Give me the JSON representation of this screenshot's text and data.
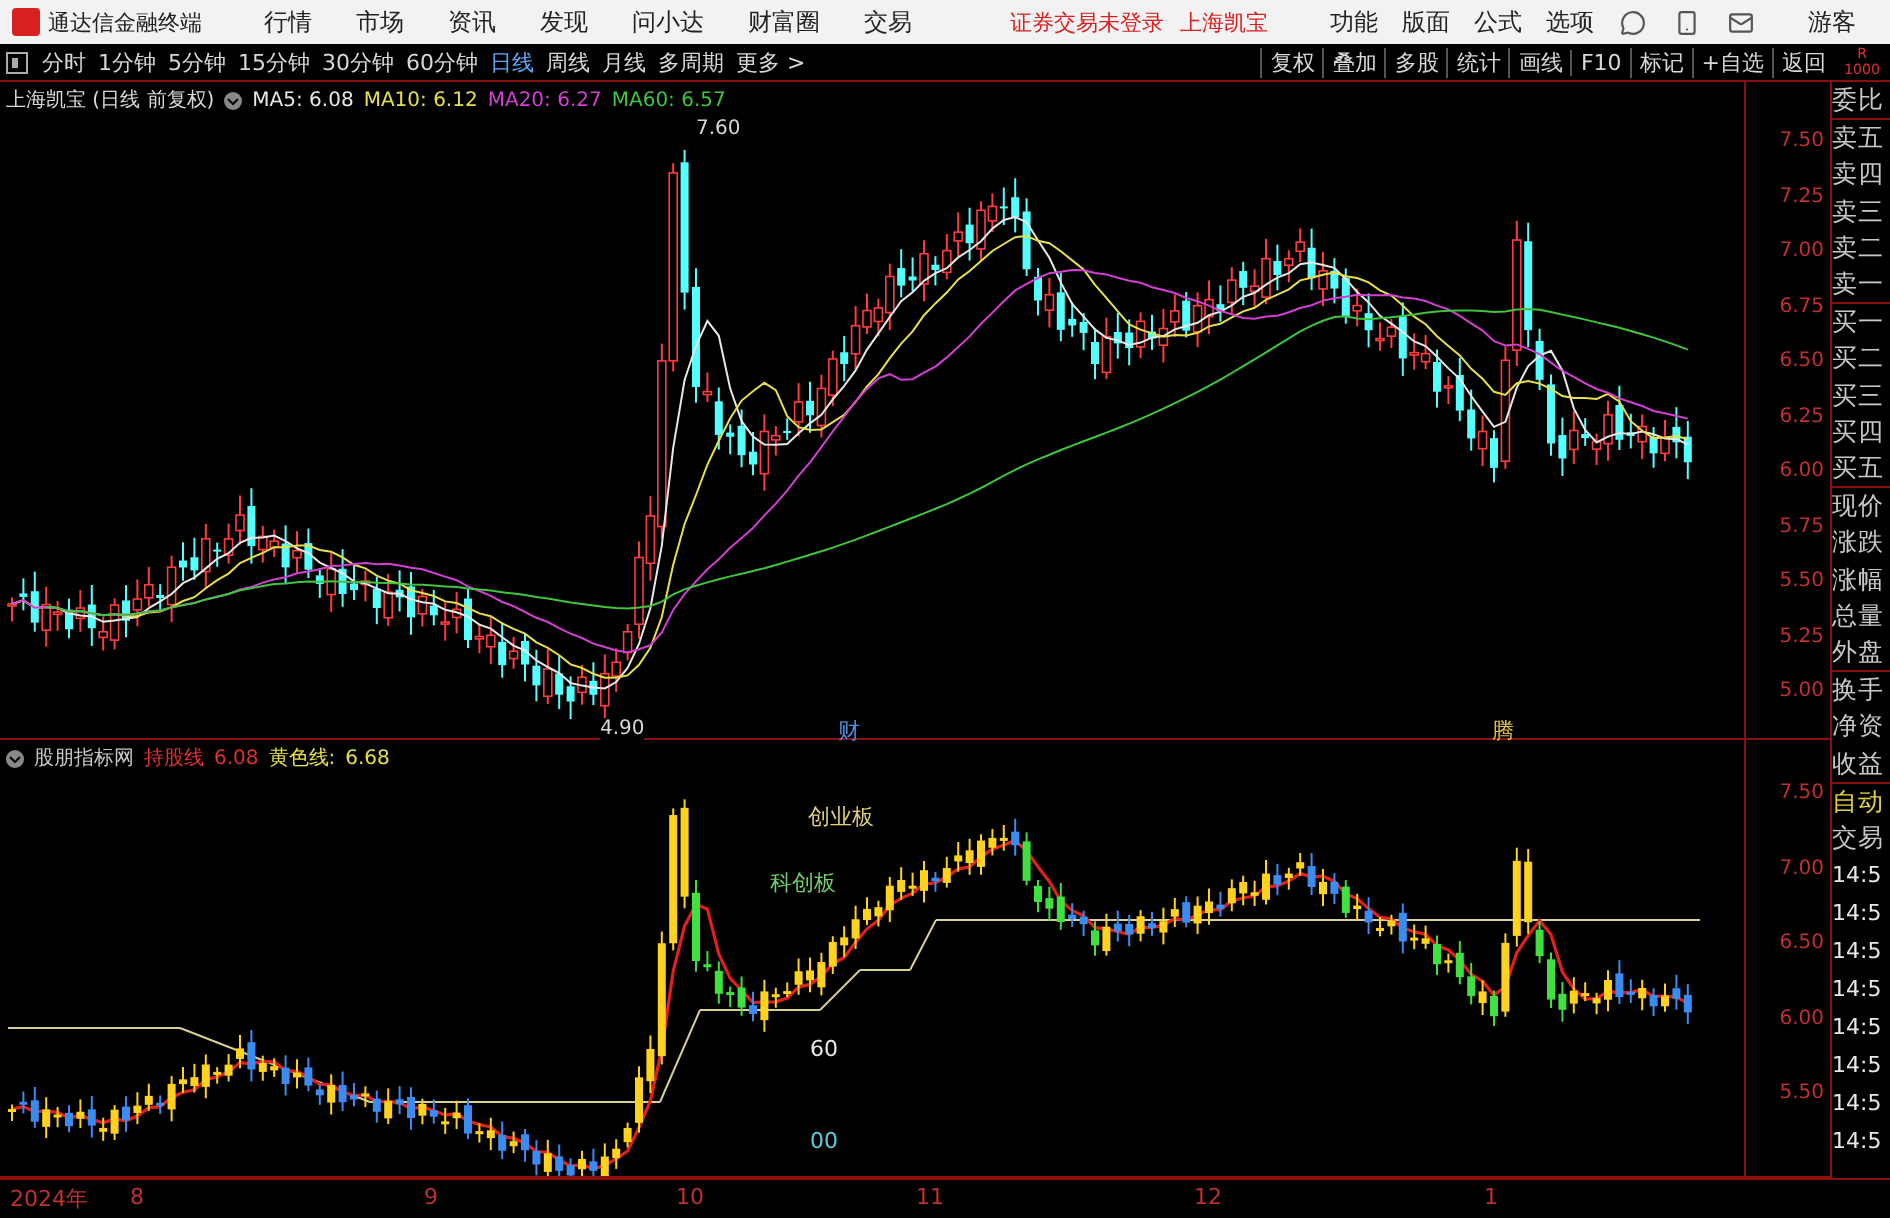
{
  "menu_bar": {
    "app_title": "通达信金融终端",
    "menus": [
      "行情",
      "市场",
      "资讯",
      "发现",
      "问小达",
      "财富圈",
      "交易"
    ],
    "notices": [
      "证券交易未登录",
      "上海凯宝"
    ],
    "right_menus": [
      "功能",
      "版面",
      "公式",
      "选项"
    ],
    "user": "游客"
  },
  "toolbar": {
    "periods": [
      {
        "label": "分时",
        "selected": false
      },
      {
        "label": "1分钟",
        "selected": false
      },
      {
        "label": "5分钟",
        "selected": false
      },
      {
        "label": "15分钟",
        "selected": false
      },
      {
        "label": "30分钟",
        "selected": false
      },
      {
        "label": "60分钟",
        "selected": false
      },
      {
        "label": "日线",
        "selected": true
      },
      {
        "label": "周线",
        "selected": false
      },
      {
        "label": "月线",
        "selected": false
      },
      {
        "label": "多周期",
        "selected": false
      },
      {
        "label": "更多 >",
        "selected": false
      }
    ],
    "tools": [
      "复权",
      "叠加",
      "多股",
      "统计",
      "画线",
      "F10",
      "标记",
      "+自选",
      "返回"
    ],
    "corner": [
      "R",
      "1000"
    ]
  },
  "main_chart": {
    "title": "上海凯宝 (日线 前复权)",
    "ma": [
      {
        "label": "MA5: 6.08",
        "color": "#e8e8e8"
      },
      {
        "label": "MA10: 6.12",
        "color": "#e8e04a"
      },
      {
        "label": "MA20: 6.27",
        "color": "#d23fd2"
      },
      {
        "label": "MA60: 6.57",
        "color": "#3fc43f"
      }
    ],
    "high_label": "7.60",
    "low_label": "4.90",
    "markers": [
      {
        "text": "财",
        "color": "#4a8fe0"
      },
      {
        "text": "腾",
        "color": "#e0c040"
      }
    ],
    "yticks": [
      "7.50",
      "7.25",
      "7.00",
      "6.75",
      "6.50",
      "6.25",
      "6.00",
      "5.75",
      "5.50",
      "5.25",
      "5.00"
    ]
  },
  "indicator": {
    "source": "股朋指标网",
    "hold_label": "持股线",
    "hold_value": "6.08",
    "yellow_label": "黄色线:",
    "yellow_value": "6.68",
    "notes": [
      {
        "text": "创业板",
        "color": "#e0d080"
      },
      {
        "text": "科创板",
        "color": "#70d070"
      },
      {
        "text": "60",
        "color": "#e8e8e8"
      },
      {
        "text": "00",
        "color": "#60c8d8"
      }
    ],
    "yticks": [
      "7.50",
      "7.00",
      "6.50",
      "6.00",
      "5.50"
    ]
  },
  "x_axis": [
    "2024年",
    "8",
    "9",
    "10",
    "11",
    "12",
    "1"
  ],
  "side_panel": {
    "groups": [
      [
        "委比"
      ],
      [
        "卖五",
        "卖四",
        "卖三",
        "卖二",
        "卖一"
      ],
      [
        "买一",
        "买二",
        "买三",
        "买四",
        "买五"
      ],
      [
        "现价",
        "涨跌",
        "涨幅",
        "总量",
        "外盘"
      ],
      [
        "换手",
        "净资",
        "收益"
      ]
    ],
    "auto": "自动",
    "trade": "交易",
    "times": [
      "14:5",
      "14:5",
      "14:5",
      "14:5",
      "14:5",
      "14:5",
      "14:5",
      "14:5"
    ]
  }
}
